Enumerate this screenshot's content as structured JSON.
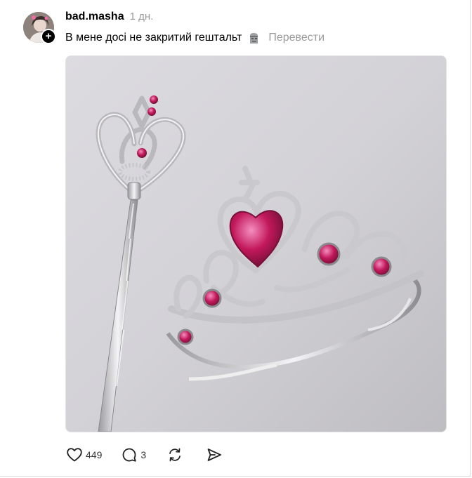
{
  "post": {
    "username": "bad.masha",
    "time": "1 дн.",
    "caption": "В мене досі не закритий гештальт",
    "caption_emoji": "moai-icon",
    "translate_label": "Перевести",
    "media_alt": "silver tiara and wand with pink gems",
    "likes": "449",
    "replies": "3"
  },
  "colors": {
    "text": "#000000",
    "muted": "#9a9a9a",
    "gem": "#c2185b"
  }
}
